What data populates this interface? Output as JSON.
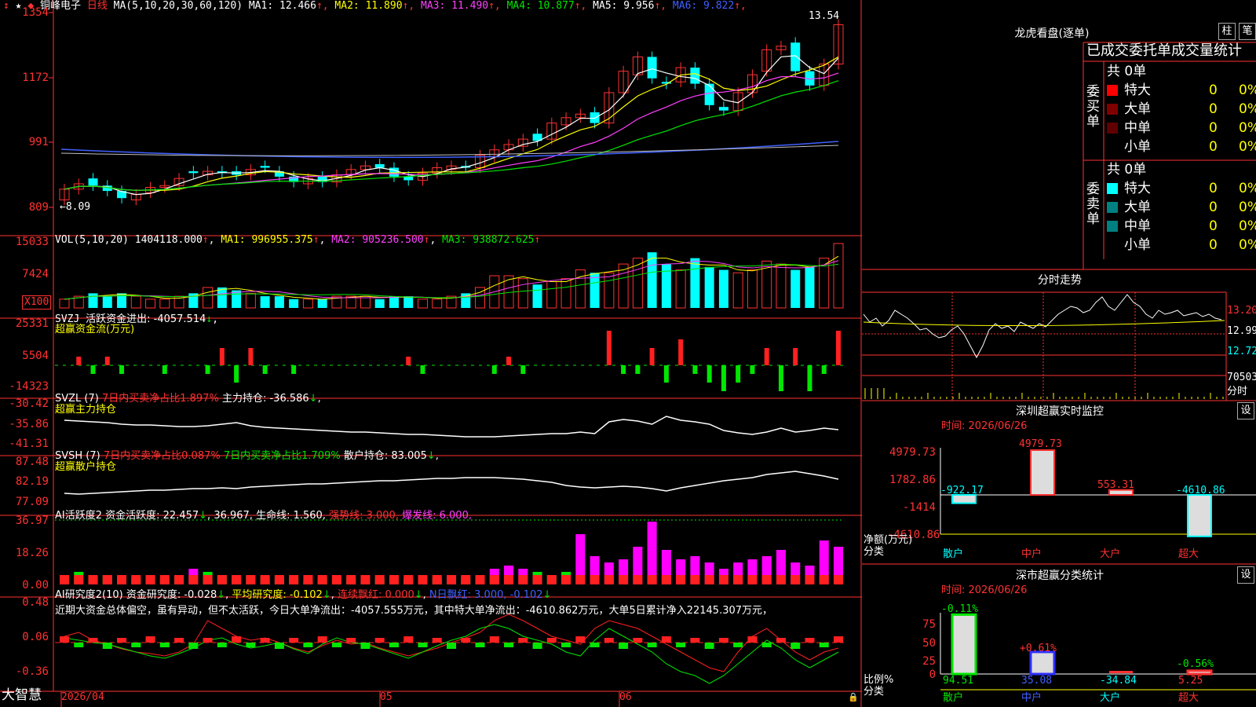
{
  "app": {
    "brand": "大智慧"
  },
  "main_chart": {
    "stock_name": "铜峰电子",
    "period": "日线",
    "ma_label": "MA(5,10,20,30,60,120)",
    "ma_values": [
      {
        "name": "MA1:",
        "value": "12.466",
        "color": "#ffffff"
      },
      {
        "name": "MA2:",
        "value": "11.890",
        "color": "#ffff00"
      },
      {
        "name": "MA3:",
        "value": "11.490",
        "color": "#ff40ff"
      },
      {
        "name": "MA4:",
        "value": "10.877",
        "color": "#00e600"
      },
      {
        "name": "MA5:",
        "value": "9.956",
        "color": "#ffffff"
      },
      {
        "name": "MA6:",
        "value": "9.822",
        "color": "#4060ff"
      }
    ],
    "y_ticks": [
      "1354",
      "1172",
      "991",
      "809"
    ],
    "high_marker": "13.54",
    "low_marker": "←8.09"
  },
  "vol_panel": {
    "label": "VOL(5,10,20)",
    "value": "1404118.000",
    "ma1": "MA1: 996955.375",
    "ma2": "MA2: 905236.500",
    "ma3": "MA3: 938872.625",
    "y_ticks": [
      "15033",
      "7424"
    ],
    "unit": "X100"
  },
  "svzj_panel": {
    "label": "SVZJ",
    "text": "活跃资金进出: -4057.514",
    "subtitle": "超赢资金流(万元)",
    "y_ticks": [
      "25331",
      "5504",
      "-14323"
    ]
  },
  "svzl_panel": {
    "label": "SVZL (7)",
    "ratio": "7日内买卖净占比1.897%",
    "text": "主力持仓: -36.586",
    "subtitle": "超赢主力持仓",
    "y_ticks": [
      "-30.42",
      "-35.86",
      "-41.31"
    ]
  },
  "svsh_panel": {
    "label": "SVSH (7)",
    "ratio1": "7日内买卖净占比0.087%",
    "ratio2": "7日内买卖净占比1.709%",
    "text": "散户持仓: 83.005",
    "subtitle": "超赢散户持仓",
    "y_ticks": [
      "87.48",
      "82.19",
      "77.09"
    ]
  },
  "ai_active_panel": {
    "label": "AI活跃度2",
    "text": "资金活跃度: 22.457",
    "v2": "36.967,",
    "life": "生命线: 1.560,",
    "strong": "强势线: 3.000,",
    "burst": "爆发线: 6.000,",
    "y_ticks": [
      "36.97",
      "18.26",
      "0.00"
    ]
  },
  "ai_research_panel": {
    "label": "AI研究度2(10)",
    "text1": "资金研究度: -0.028",
    "text2": "平均研究度: -0.102",
    "text3": "连续飘红: 0.000",
    "text4": "N日飘红: 3.000, -0.102",
    "comment": "近期大资金总体偏空，虽有异动，但不太活跃，今日大单净流出：-4057.555万元，其中特大单净流出：-4610.862万元，大单5日累计净入22145.307万元，",
    "y_ticks": [
      "0.48",
      "0.06",
      "-0.36"
    ]
  },
  "x_axis": {
    "labels": [
      "2026/04",
      "05",
      "06"
    ]
  },
  "dragon_tiger": {
    "title": "龙虎看盘(逐单)",
    "btn_bar": "柱",
    "btn_stroke": "笔",
    "tabs": [
      "已成交",
      "委托单",
      "成交量",
      "统计"
    ],
    "buy_label": "委买单",
    "sell_label": "委卖单",
    "buy_total": "共 0单",
    "sell_total": "共 0单",
    "buy_rows": [
      {
        "name": "特大",
        "count": "0",
        "pct": "0%",
        "color": "#ff0000"
      },
      {
        "name": "大单",
        "count": "0",
        "pct": "0%",
        "color": "#800000"
      },
      {
        "name": "中单",
        "count": "0",
        "pct": "0%",
        "color": "#600000"
      },
      {
        "name": "小单",
        "count": "0",
        "pct": "0%",
        "color": "#000000"
      }
    ],
    "sell_rows": [
      {
        "name": "特大",
        "count": "0",
        "pct": "0%",
        "color": "#00ffff"
      },
      {
        "name": "大单",
        "count": "0",
        "pct": "0%",
        "color": "#008080"
      },
      {
        "name": "中单",
        "count": "0",
        "pct": "0%",
        "color": "#008080"
      },
      {
        "name": "小单",
        "count": "0",
        "pct": "0%",
        "color": "#000000"
      }
    ]
  },
  "intraday": {
    "title": "分时走势",
    "prices": [
      "13.20",
      "12.99",
      "12.72"
    ],
    "vol_label": "70503",
    "time_label": "分时"
  },
  "sz_monitor": {
    "title": "深圳超赢实时监控",
    "btn": "设",
    "date": "时间: 2026/06/26",
    "y_ticks": [
      "4979.73",
      "1782.86",
      "-1414",
      "-4610.86"
    ],
    "y_unit": "净额(万元)",
    "x_unit": "分类",
    "chart_data": {
      "type": "bar",
      "categories": [
        "散户",
        "中户",
        "大户",
        "超大"
      ],
      "values": [
        -922.17,
        4979.73,
        553.31,
        -4610.86
      ],
      "labels": [
        "-922.17",
        "4979.73",
        "553.31",
        "-4610.86"
      ]
    }
  },
  "sz_class": {
    "title": "深市超赢分类统计",
    "btn": "设",
    "date": "时间: 2026/06/26",
    "y_ticks": [
      "75",
      "50",
      "25",
      "0"
    ],
    "y_unit": "比例%",
    "x_unit": "分类",
    "chart_data": {
      "type": "bar",
      "categories": [
        "散户",
        "中户",
        "大户",
        "超大"
      ],
      "values": [
        94.51,
        35.08,
        -34.84,
        5.25
      ],
      "top_labels": [
        "-0.11%",
        "+0.61%",
        "",
        "-0.56%"
      ],
      "bottom_labels": [
        "94.51",
        "35.08",
        "-34.84",
        "5.25"
      ]
    }
  }
}
